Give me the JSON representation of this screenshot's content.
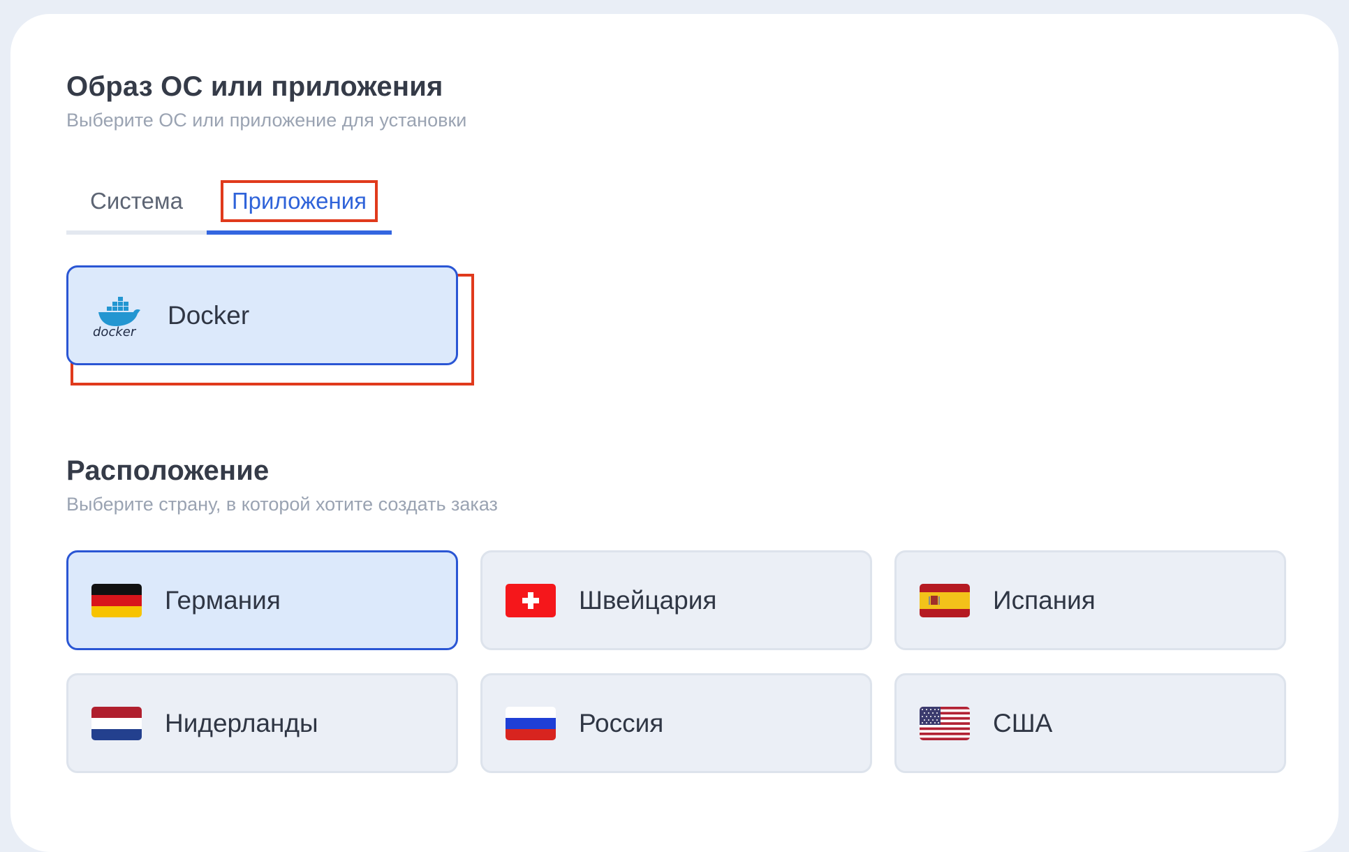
{
  "image_section": {
    "title": "Образ ОС или приложения",
    "subtitle": "Выберите ОС или приложение для установки",
    "tabs": [
      {
        "label": "Система",
        "active": false
      },
      {
        "label": "Приложения",
        "active": true
      }
    ],
    "apps": [
      {
        "label": "Docker",
        "icon": "docker-logo-icon",
        "logo_text": "docker",
        "selected": true
      }
    ]
  },
  "location_section": {
    "title": "Расположение",
    "subtitle": "Выберите страну, в которой хотите создать заказ",
    "countries": [
      {
        "label": "Германия",
        "icon": "germany-flag-icon",
        "selected": true
      },
      {
        "label": "Швейцария",
        "icon": "switzerland-flag-icon",
        "selected": false
      },
      {
        "label": "Испания",
        "icon": "spain-flag-icon",
        "selected": false
      },
      {
        "label": "Нидерланды",
        "icon": "netherlands-flag-icon",
        "selected": false
      },
      {
        "label": "Россия",
        "icon": "russia-flag-icon",
        "selected": false
      },
      {
        "label": "США",
        "icon": "usa-flag-icon",
        "selected": false
      }
    ]
  },
  "colors": {
    "accent": "#3366e0",
    "selected_bg": "#dce9fb",
    "highlight": "#e03a1c"
  }
}
